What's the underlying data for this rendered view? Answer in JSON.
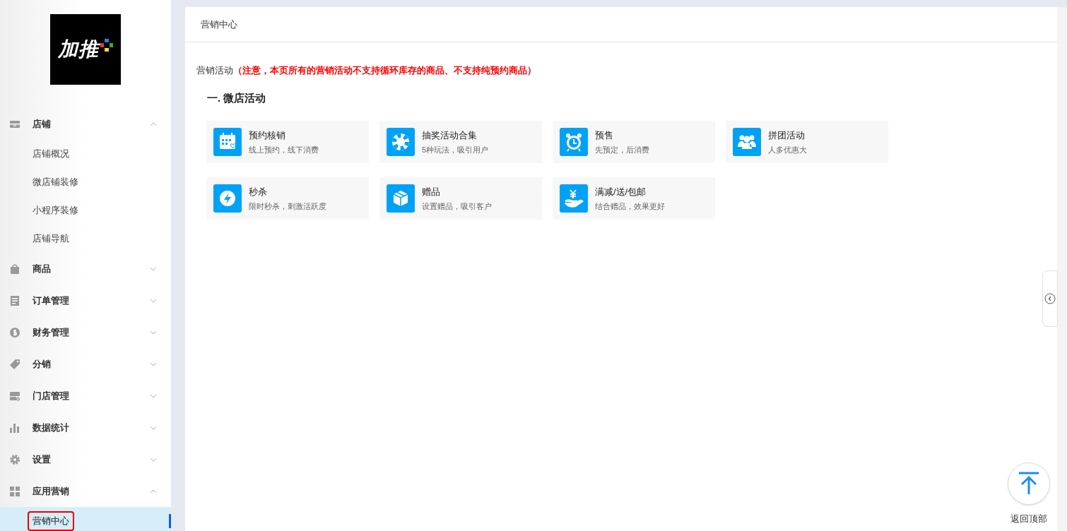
{
  "logo": {
    "text": "加推"
  },
  "sidebar": {
    "items": [
      {
        "label": "店铺",
        "expanded": true,
        "children": [
          {
            "label": "店铺概况",
            "selected": false,
            "outlined": false
          },
          {
            "label": "微店铺装修",
            "selected": false,
            "outlined": false
          },
          {
            "label": "小程序装修",
            "selected": false,
            "outlined": false
          },
          {
            "label": "店铺导航",
            "selected": false,
            "outlined": false
          }
        ]
      },
      {
        "label": "商品",
        "expanded": false
      },
      {
        "label": "订单管理",
        "expanded": false
      },
      {
        "label": "财务管理",
        "expanded": false
      },
      {
        "label": "分销",
        "expanded": false
      },
      {
        "label": "门店管理",
        "expanded": false
      },
      {
        "label": "数据统计",
        "expanded": false
      },
      {
        "label": "设置",
        "expanded": false
      },
      {
        "label": "应用营销",
        "expanded": true,
        "children": [
          {
            "label": "营销中心",
            "selected": true,
            "outlined": true
          }
        ]
      }
    ]
  },
  "page_title": "营销中心",
  "notice": {
    "label": "营销活动",
    "warning": "（注意，本页所有的营销活动不支持循环库存的商品、不支持纯预约商品）"
  },
  "section": {
    "title": "一. 微店活动",
    "cards": [
      {
        "title": "预约核销",
        "subtitle": "线上预约，线下消费"
      },
      {
        "title": "抽奖活动合集",
        "subtitle": "5种玩法，吸引用户"
      },
      {
        "title": "预售",
        "subtitle": "先预定，后消费"
      },
      {
        "title": "拼团活动",
        "subtitle": "人多优惠大"
      },
      {
        "title": "秒杀",
        "subtitle": "限时秒杀，刺激活跃度"
      },
      {
        "title": "赠品",
        "subtitle": "设置赠品，吸引客户"
      },
      {
        "title": "满减/送/包邮",
        "subtitle": "结合赠品，效果更好"
      }
    ]
  },
  "back_to_top": "返回顶部"
}
